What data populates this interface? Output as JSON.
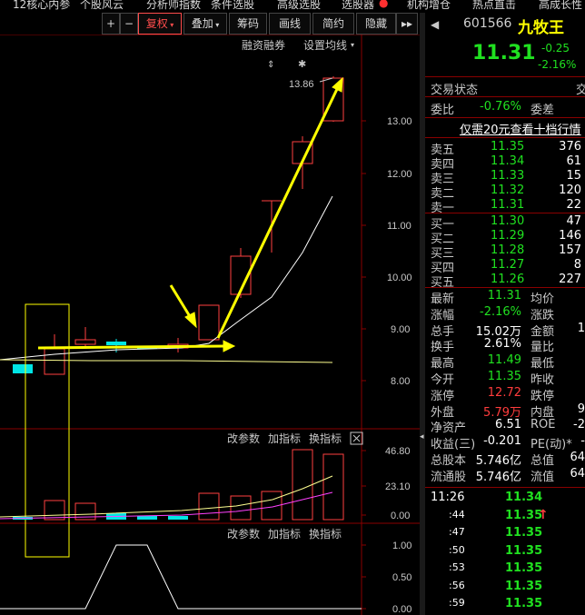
{
  "menu": [
    "12核心内参",
    "个股风云",
    "分析师指数",
    "条件选股",
    "高级选股",
    "选股器",
    "机构增仓",
    "热点直击",
    "高成长性"
  ],
  "toolbar": {
    "plus": "+",
    "minus": "−",
    "fuquan": "复权",
    "diejia": "叠加",
    "chouma": "筹码",
    "huaxian": "画线",
    "jianyue": "简约",
    "yincang": "隐藏"
  },
  "chart_links": {
    "rongzi": "融资融券",
    "shezhi": "设置均线",
    "last_price_label": "13.86"
  },
  "y_ticks_main": [
    "13.00",
    "12.00",
    "11.00",
    "10.00",
    "9.00",
    "8.00"
  ],
  "vol_panel": {
    "links": [
      "改参数",
      "加指标",
      "换指标"
    ],
    "ticks": [
      "46.80",
      "23.10",
      "0.00"
    ]
  },
  "ind_panel": {
    "links": [
      "改参数",
      "加指标",
      "换指标"
    ],
    "ticks": [
      "1.00",
      "0.50",
      "0.00"
    ]
  },
  "close_icon": "⊠",
  "stock": {
    "code": "601566",
    "name": "九牧王",
    "price": "11.31",
    "change": "-0.25",
    "change_pct": "-2.16%"
  },
  "status": {
    "label": "交易状态",
    "extra": "交"
  },
  "weibi": {
    "label": "委比",
    "value": "-0.76%",
    "label2": "委差"
  },
  "promo": "仅需20元查看十档行情",
  "sells": [
    {
      "label": "卖五",
      "price": "11.35",
      "vol": "376"
    },
    {
      "label": "卖四",
      "price": "11.34",
      "vol": "61"
    },
    {
      "label": "卖三",
      "price": "11.33",
      "vol": "15"
    },
    {
      "label": "卖二",
      "price": "11.32",
      "vol": "120"
    },
    {
      "label": "卖一",
      "price": "11.31",
      "vol": "22"
    }
  ],
  "buys": [
    {
      "label": "买一",
      "price": "11.30",
      "vol": "47"
    },
    {
      "label": "买二",
      "price": "11.29",
      "vol": "146"
    },
    {
      "label": "买三",
      "price": "11.28",
      "vol": "157"
    },
    {
      "label": "买四",
      "price": "11.27",
      "vol": "8"
    },
    {
      "label": "买五",
      "price": "11.26",
      "vol": "227"
    }
  ],
  "stats": [
    {
      "l1": "最新",
      "v1": "11.31",
      "c1": "green",
      "l2": "均价",
      "v2": ""
    },
    {
      "l1": "涨幅",
      "v1": "-2.16%",
      "c1": "green",
      "l2": "涨跌",
      "v2": ""
    },
    {
      "l1": "总手",
      "v1": "15.02万",
      "c1": "white",
      "l2": "金额",
      "v2": "1"
    },
    {
      "l1": "换手",
      "v1": "2.61%",
      "c1": "white",
      "l2": "量比",
      "v2": ""
    },
    {
      "l1": "最高",
      "v1": "11.49",
      "c1": "green",
      "l2": "最低",
      "v2": ""
    },
    {
      "l1": "今开",
      "v1": "11.35",
      "c1": "green",
      "l2": "昨收",
      "v2": ""
    },
    {
      "l1": "涨停",
      "v1": "12.72",
      "c1": "red",
      "l2": "跌停",
      "v2": ""
    },
    {
      "l1": "外盘",
      "v1": "5.79万",
      "c1": "red",
      "l2": "内盘",
      "v2": "9"
    },
    {
      "l1": "净资产",
      "v1": "6.51",
      "c1": "white",
      "l2": "ROE",
      "v2": "-2"
    },
    {
      "l1": "收益(三)",
      "v1": "-0.201",
      "c1": "white",
      "l2": "PE(动)*",
      "v2": "-"
    },
    {
      "l1": "总股本",
      "v1": "5.746亿",
      "c1": "white",
      "l2": "总值",
      "v2": "64"
    },
    {
      "l1": "流通股",
      "v1": "5.746亿",
      "c1": "white",
      "l2": "流值",
      "v2": "64"
    }
  ],
  "ticks": [
    {
      "time": "11:26",
      "price": "11.34",
      "arrow": ""
    },
    {
      "time": ":44",
      "price": "11.35",
      "arrow": "↑"
    },
    {
      "time": ":47",
      "price": "11.35",
      "arrow": ""
    },
    {
      "time": ":50",
      "price": "11.35",
      "arrow": ""
    },
    {
      "time": ":53",
      "price": "11.35",
      "arrow": ""
    },
    {
      "time": ":56",
      "price": "11.35",
      "arrow": ""
    },
    {
      "time": ":59",
      "price": "11.35",
      "arrow": ""
    }
  ]
}
